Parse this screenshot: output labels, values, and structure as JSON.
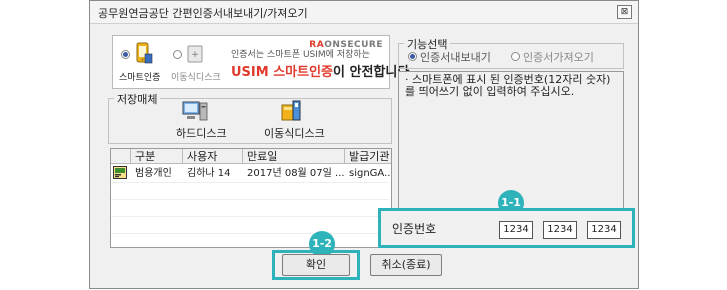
{
  "window": {
    "title": "공무원연금공단 간편인증서내보내기/가져오기",
    "close_glyph": "⊠"
  },
  "banner": {
    "brand_prefix": "R",
    "brand_a": "A",
    "brand_rest": "ONSECURE",
    "option_smartphone": "스마트인증",
    "option_removable": "이동식디스크",
    "line1": "인증서는 스마트폰 USIM에 저장하는",
    "line2_accent": "USIM 스마트인증",
    "line2_rest": "이 안전합니다"
  },
  "storage": {
    "group_label": "저장매체",
    "items": [
      {
        "label": "하드디스크"
      },
      {
        "label": "이동식디스크"
      }
    ]
  },
  "table": {
    "headers": [
      "구분",
      "사용자",
      "만료일",
      "발급기관"
    ],
    "rows": [
      {
        "type": "범용개인",
        "user": "김하나 14",
        "expiry": "2017년 08월 07일 ...",
        "issuer": "signGA..."
      }
    ]
  },
  "function_select": {
    "group_label": "기능선택",
    "export_label": "인증서내보내기",
    "import_label": "인증서가져오기",
    "selected": "export"
  },
  "description": "· 스마트폰에 표시 된 인증번호(12자리 숫자)를 띄어쓰기 없이 입력하여 주십시오.",
  "auth": {
    "label": "인증번호",
    "codes": [
      "1234",
      "1234",
      "1234"
    ]
  },
  "callouts": {
    "c1": "1-1",
    "c2": "1-2"
  },
  "buttons": {
    "confirm": "확인",
    "cancel": "취소(종료)"
  },
  "colors": {
    "highlight": "#2fb3ba",
    "accent": "#e03a2c"
  }
}
